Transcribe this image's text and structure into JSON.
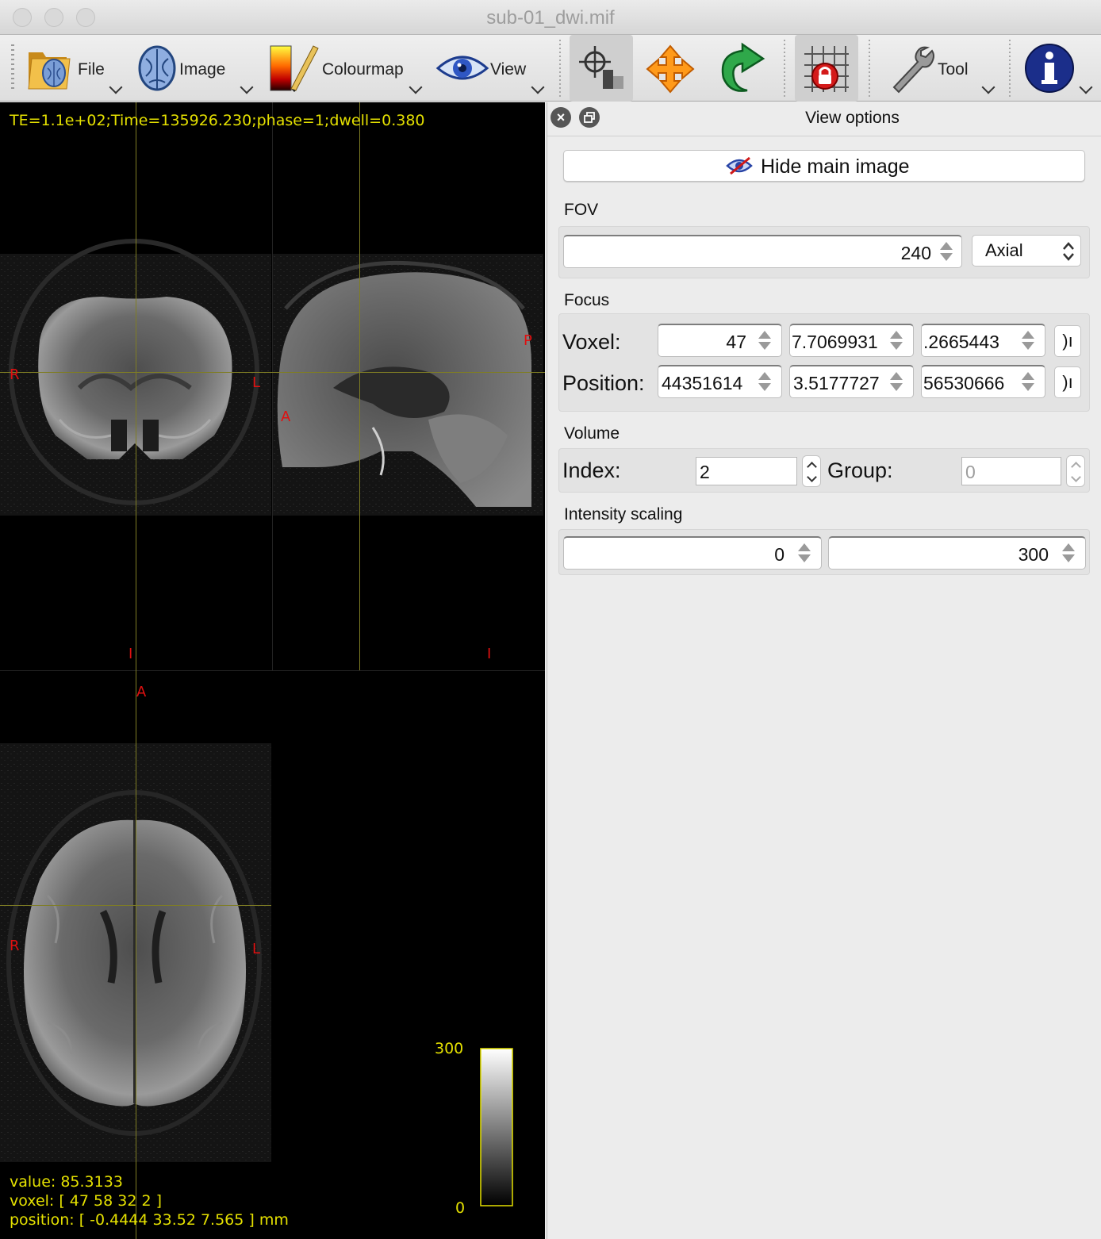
{
  "window": {
    "title": "sub-01_dwi.mif"
  },
  "toolbar": {
    "file_label": "File",
    "image_label": "Image",
    "colourmap_label": "Colourmap",
    "view_label": "View",
    "tool_label": "Tool"
  },
  "viewer": {
    "header": "TE=1.1e+02;Time=135926.230;phase=1;dwell=0.380",
    "orientation": {
      "coronal_right": "R",
      "coronal_left": "L",
      "coronal_inferior": "I",
      "sagittal_posterior": "P",
      "sagittal_anterior": "A",
      "sagittal_inferior": "I",
      "axial_anterior": "A",
      "axial_right": "R",
      "axial_left": "L"
    },
    "colorbar": {
      "max": "300",
      "min": "0"
    },
    "status": {
      "value": "value: 85.3133",
      "voxel": "voxel: [ 47 58 32 2 ]",
      "position": "position: [ -0.4444 33.52 7.565 ] mm"
    },
    "overlay_text_color": "#e4e000",
    "orientation_label_color": "#e01010"
  },
  "panel": {
    "title": "View options",
    "hide_main_image_label": "Hide main image",
    "fov": {
      "label": "FOV",
      "value": "240",
      "plane": "Axial"
    },
    "focus": {
      "label": "Focus",
      "voxel_label": "Voxel:",
      "voxel": [
        "47",
        "7.7069931",
        ".2665443"
      ],
      "position_label": "Position:",
      "position": [
        "44351614",
        "3.5177727",
        "56530666"
      ],
      "button_glyph": ")ı"
    },
    "volume": {
      "label": "Volume",
      "index_label": "Index:",
      "index_value": "2",
      "group_label": "Group:",
      "group_value": "0"
    },
    "intensity": {
      "label": "Intensity scaling",
      "min": "0",
      "max": "300"
    }
  }
}
